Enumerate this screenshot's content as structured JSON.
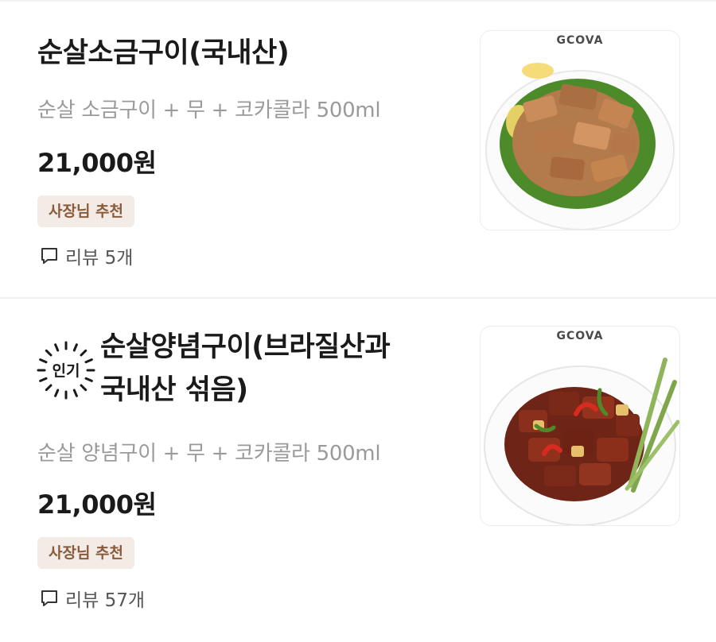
{
  "menu_items": [
    {
      "title": "순살소금구이(국내산)",
      "title_line1": "순살소금구이(국내산)",
      "description": "순살 소금구이 + 무 + 코카콜라 500ml",
      "price": "21,000원",
      "badge": "사장님 추천",
      "review_label": "리뷰 5개",
      "image_brand": "GCOVA",
      "image_icon": "salt-grilled-pork-photo"
    },
    {
      "popular_badge": "인기",
      "title_line1": "순살양념구이(브라질산과",
      "title_line2": "국내산 섞음)",
      "description": "순살 양념구이 + 무 + 코카콜라 500ml",
      "price": "21,000원",
      "badge": "사장님 추천",
      "review_label": "리뷰 57개",
      "image_brand": "GCOVA",
      "image_icon": "spicy-marinated-pork-photo"
    }
  ],
  "colors": {
    "badge_bg": "#f3ece6",
    "badge_text": "#8b5a3a",
    "description": "#9a9a9a"
  },
  "icons": {
    "review": "speech-bubble-icon"
  }
}
